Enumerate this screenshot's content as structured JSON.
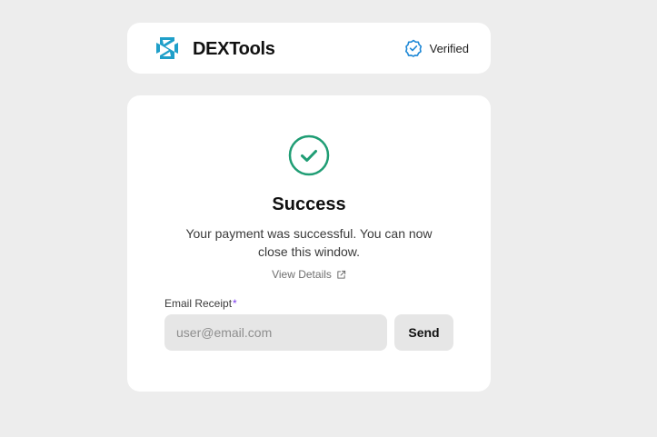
{
  "header": {
    "brand_name": "DEXTools",
    "logo_icon": "dextools-logo-icon",
    "verified_icon": "verified-badge-icon",
    "verified_label": "Verified"
  },
  "main": {
    "status_icon": "check-circle-icon",
    "title": "Success",
    "message": "Your payment was successful. You can now close this window.",
    "view_details_label": "View Details",
    "view_details_icon": "external-link-icon",
    "email": {
      "label": "Email Receipt",
      "required_mark": "*",
      "value": "",
      "placeholder": "user@email.com"
    },
    "send_label": "Send"
  },
  "colors": {
    "page_background": "#ededed",
    "card_background": "#ffffff",
    "brand_teal": "#1f9fc9",
    "verified_blue": "#1e88d6",
    "success_green": "#1f9d74",
    "required_purple": "#7c3aed",
    "input_background": "#e6e6e6"
  }
}
